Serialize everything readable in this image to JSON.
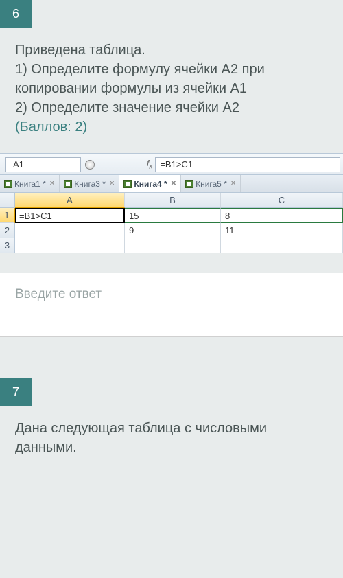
{
  "q6": {
    "number": "6",
    "intro": "Приведена таблица.",
    "part1": "1) Определите формулу ячейки A2 при копировании формулы из ячейки A1",
    "part2": "2) Определите значение ячейки A2",
    "points": "(Баллов: 2)"
  },
  "excel": {
    "name_box": "A1",
    "fx": "f",
    "fx_sub": "x",
    "formula": "=B1>C1",
    "tabs": [
      {
        "label": "Книга1 *",
        "active": false
      },
      {
        "label": "Книга3 *",
        "active": false
      },
      {
        "label": "Книга4 *",
        "active": true
      },
      {
        "label": "Книга5 *",
        "active": false
      }
    ],
    "columns": [
      "A",
      "B",
      "C"
    ],
    "rows": [
      "1",
      "2",
      "3"
    ],
    "cells": {
      "a1": "=B1>C1",
      "b1": "15",
      "c1": "8",
      "a2": "",
      "b2": "9",
      "c2": "11",
      "a3": "",
      "b3": "",
      "c3": ""
    }
  },
  "answer": {
    "placeholder": "Введите ответ"
  },
  "q7": {
    "number": "7",
    "text": "Дана следующая таблица с числовыми данными."
  }
}
